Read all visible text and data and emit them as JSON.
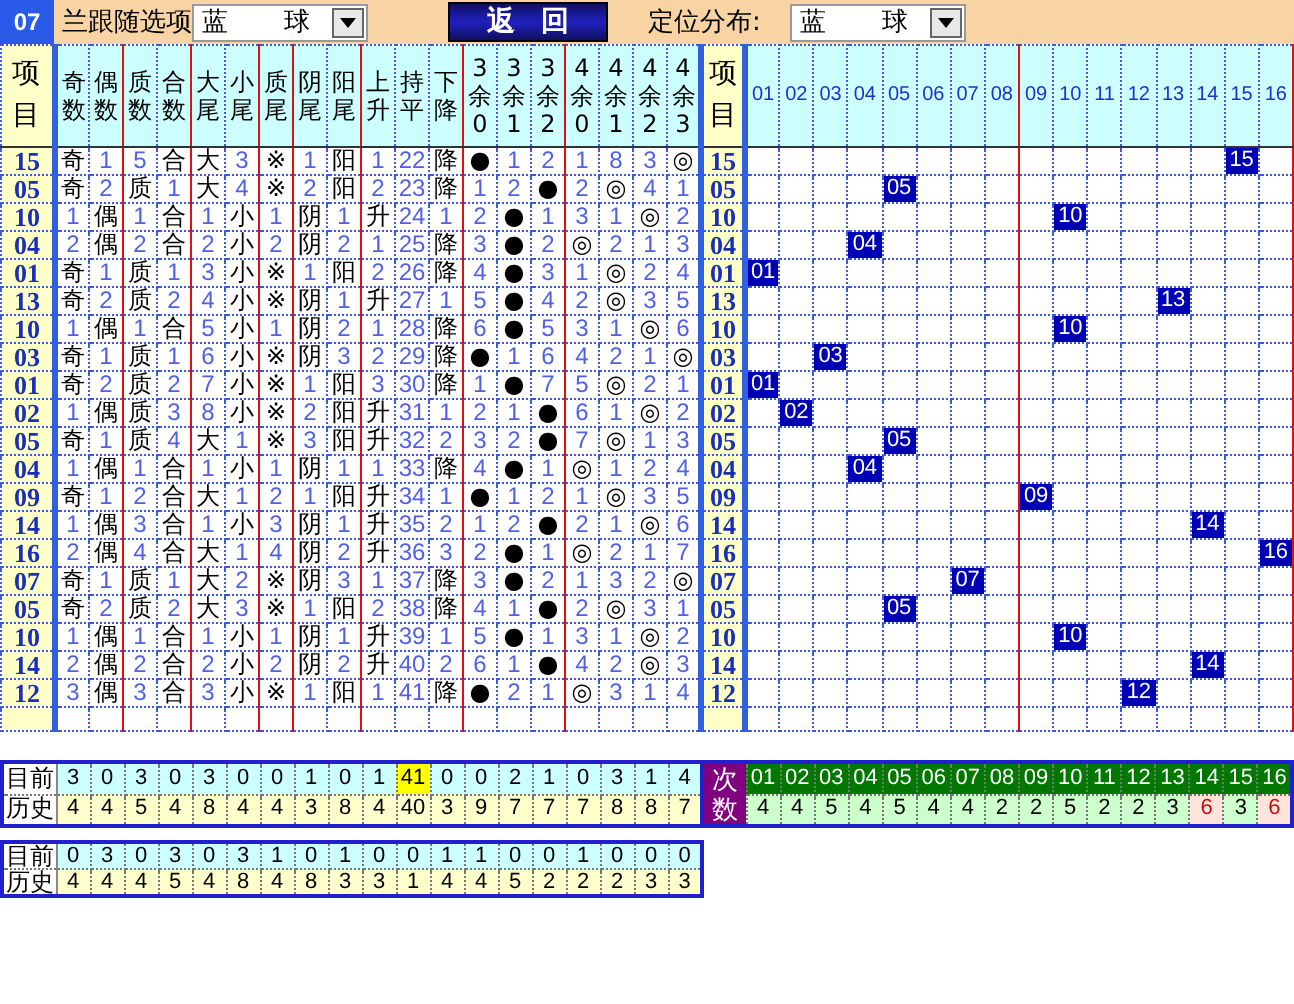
{
  "top_bar": {
    "badge": "07",
    "label": "兰跟随选项",
    "select_1": {
      "value": "蓝 球"
    },
    "button": "返 回",
    "label_2": "定位分布:",
    "select_2": {
      "value": "蓝 球"
    }
  },
  "table": {
    "item_header": "项目",
    "column_groups": [
      {
        "columns": [
          "奇数",
          "偶数"
        ]
      },
      {
        "columns": [
          "质数",
          "合数"
        ]
      },
      {
        "columns": [
          "大尾",
          "小尾"
        ]
      },
      {
        "columns": [
          "质尾"
        ]
      },
      {
        "columns": [
          "阴尾",
          "阳尾"
        ]
      },
      {
        "columns": [
          "上升",
          "持平",
          "下降"
        ]
      },
      {
        "columns": [
          "3余0",
          "3余1",
          "3余2"
        ]
      },
      {
        "columns": [
          "4余0",
          "4余1",
          "4余2",
          "4余3"
        ]
      }
    ],
    "item_header_2": "项目",
    "grid_groups": [
      {
        "columns": [
          "01",
          "02",
          "03",
          "04",
          "05",
          "06",
          "07",
          "08"
        ]
      },
      {
        "columns": [
          "09",
          "10",
          "11",
          "12",
          "13",
          "14",
          "15",
          "16"
        ]
      }
    ],
    "rows": [
      {
        "item": "15",
        "cells": [
          "奇",
          "1",
          "5",
          "合",
          "大",
          "3",
          "※",
          "1",
          "阳",
          "1",
          "22",
          "降",
          "●",
          "1",
          "2",
          "1",
          "8",
          "3",
          "◎"
        ],
        "hit": [
          true,
          false,
          false,
          true,
          true,
          false,
          true,
          false,
          true,
          false,
          false,
          true,
          true,
          false,
          false,
          false,
          false,
          false,
          true
        ],
        "item_2": "15",
        "ball": "15",
        "grid_hits": [
          false,
          false,
          false,
          false,
          false,
          false,
          false,
          false,
          false,
          false,
          false,
          false,
          false,
          false,
          true,
          false
        ]
      },
      {
        "item": "05",
        "cells": [
          "奇",
          "2",
          "质",
          "1",
          "大",
          "4",
          "※",
          "2",
          "阳",
          "2",
          "23",
          "降",
          "1",
          "2",
          "●",
          "2",
          "◎",
          "4",
          "1"
        ],
        "hit": [
          true,
          false,
          true,
          false,
          true,
          false,
          true,
          false,
          true,
          false,
          false,
          true,
          false,
          false,
          true,
          false,
          true,
          false,
          false
        ],
        "item_2": "05",
        "ball": "05",
        "grid_hits": [
          false,
          false,
          false,
          false,
          true,
          false,
          false,
          false,
          false,
          false,
          false,
          false,
          false,
          false,
          false,
          false
        ]
      },
      {
        "item": "10",
        "cells": [
          "1",
          "偶",
          "1",
          "合",
          "1",
          "小",
          "1",
          "阴",
          "1",
          "升",
          "24",
          "1",
          "2",
          "●",
          "1",
          "3",
          "1",
          "◎",
          "2"
        ],
        "hit": [
          false,
          true,
          false,
          true,
          false,
          true,
          false,
          true,
          false,
          true,
          false,
          false,
          false,
          true,
          false,
          false,
          false,
          true,
          false
        ],
        "item_2": "10",
        "ball": "10",
        "grid_hits": [
          false,
          false,
          false,
          false,
          false,
          false,
          false,
          false,
          false,
          true,
          false,
          false,
          false,
          false,
          false,
          false
        ]
      },
      {
        "item": "04",
        "cells": [
          "2",
          "偶",
          "2",
          "合",
          "2",
          "小",
          "2",
          "阴",
          "2",
          "1",
          "25",
          "降",
          "3",
          "●",
          "2",
          "◎",
          "2",
          "1",
          "3"
        ],
        "hit": [
          false,
          true,
          false,
          true,
          false,
          true,
          false,
          true,
          false,
          false,
          false,
          true,
          false,
          true,
          false,
          true,
          false,
          false,
          false
        ],
        "item_2": "04",
        "ball": "04",
        "grid_hits": [
          false,
          false,
          false,
          true,
          false,
          false,
          false,
          false,
          false,
          false,
          false,
          false,
          false,
          false,
          false,
          false
        ]
      },
      {
        "item": "01",
        "cells": [
          "奇",
          "1",
          "质",
          "1",
          "3",
          "小",
          "※",
          "1",
          "阳",
          "2",
          "26",
          "降",
          "4",
          "●",
          "3",
          "1",
          "◎",
          "2",
          "4"
        ],
        "hit": [
          true,
          false,
          true,
          false,
          false,
          true,
          true,
          false,
          true,
          false,
          false,
          true,
          false,
          true,
          false,
          false,
          true,
          false,
          false
        ],
        "item_2": "01",
        "ball": "01",
        "grid_hits": [
          true,
          false,
          false,
          false,
          false,
          false,
          false,
          false,
          false,
          false,
          false,
          false,
          false,
          false,
          false,
          false
        ]
      },
      {
        "item": "13",
        "cells": [
          "奇",
          "2",
          "质",
          "2",
          "4",
          "小",
          "※",
          "阴",
          "1",
          "升",
          "27",
          "1",
          "5",
          "●",
          "4",
          "2",
          "◎",
          "3",
          "5"
        ],
        "hit": [
          true,
          false,
          true,
          false,
          false,
          true,
          true,
          true,
          false,
          true,
          false,
          false,
          false,
          true,
          false,
          false,
          true,
          false,
          false
        ],
        "item_2": "13",
        "ball": "13",
        "grid_hits": [
          false,
          false,
          false,
          false,
          false,
          false,
          false,
          false,
          false,
          false,
          false,
          false,
          true,
          false,
          false,
          false
        ]
      },
      {
        "item": "10",
        "cells": [
          "1",
          "偶",
          "1",
          "合",
          "5",
          "小",
          "1",
          "阴",
          "2",
          "1",
          "28",
          "降",
          "6",
          "●",
          "5",
          "3",
          "1",
          "◎",
          "6"
        ],
        "hit": [
          false,
          true,
          false,
          true,
          false,
          true,
          false,
          true,
          false,
          false,
          false,
          true,
          false,
          true,
          false,
          false,
          false,
          true,
          false
        ],
        "item_2": "10",
        "ball": "10",
        "grid_hits": [
          false,
          false,
          false,
          false,
          false,
          false,
          false,
          false,
          false,
          true,
          false,
          false,
          false,
          false,
          false,
          false
        ]
      },
      {
        "item": "03",
        "cells": [
          "奇",
          "1",
          "质",
          "1",
          "6",
          "小",
          "※",
          "阴",
          "3",
          "2",
          "29",
          "降",
          "●",
          "1",
          "6",
          "4",
          "2",
          "1",
          "◎"
        ],
        "hit": [
          true,
          false,
          true,
          false,
          false,
          true,
          true,
          true,
          false,
          false,
          false,
          true,
          true,
          false,
          false,
          false,
          false,
          false,
          true
        ],
        "item_2": "03",
        "ball": "03",
        "grid_hits": [
          false,
          false,
          true,
          false,
          false,
          false,
          false,
          false,
          false,
          false,
          false,
          false,
          false,
          false,
          false,
          false
        ]
      },
      {
        "item": "01",
        "cells": [
          "奇",
          "2",
          "质",
          "2",
          "7",
          "小",
          "※",
          "1",
          "阳",
          "3",
          "30",
          "降",
          "1",
          "●",
          "7",
          "5",
          "◎",
          "2",
          "1"
        ],
        "hit": [
          true,
          false,
          true,
          false,
          false,
          true,
          true,
          false,
          true,
          false,
          false,
          true,
          false,
          true,
          false,
          false,
          true,
          false,
          false
        ],
        "item_2": "01",
        "ball": "01",
        "grid_hits": [
          true,
          false,
          false,
          false,
          false,
          false,
          false,
          false,
          false,
          false,
          false,
          false,
          false,
          false,
          false,
          false
        ]
      },
      {
        "item": "02",
        "cells": [
          "1",
          "偶",
          "质",
          "3",
          "8",
          "小",
          "※",
          "2",
          "阳",
          "升",
          "31",
          "1",
          "2",
          "1",
          "●",
          "6",
          "1",
          "◎",
          "2"
        ],
        "hit": [
          false,
          true,
          true,
          false,
          false,
          true,
          true,
          false,
          true,
          true,
          false,
          false,
          false,
          false,
          true,
          false,
          false,
          true,
          false
        ],
        "item_2": "02",
        "ball": "02",
        "grid_hits": [
          false,
          true,
          false,
          false,
          false,
          false,
          false,
          false,
          false,
          false,
          false,
          false,
          false,
          false,
          false,
          false
        ]
      },
      {
        "item": "05",
        "cells": [
          "奇",
          "1",
          "质",
          "4",
          "大",
          "1",
          "※",
          "3",
          "阳",
          "升",
          "32",
          "2",
          "3",
          "2",
          "●",
          "7",
          "◎",
          "1",
          "3"
        ],
        "hit": [
          true,
          false,
          true,
          false,
          true,
          false,
          true,
          false,
          true,
          true,
          false,
          false,
          false,
          false,
          true,
          false,
          true,
          false,
          false
        ],
        "item_2": "05",
        "ball": "05",
        "grid_hits": [
          false,
          false,
          false,
          false,
          true,
          false,
          false,
          false,
          false,
          false,
          false,
          false,
          false,
          false,
          false,
          false
        ]
      },
      {
        "item": "04",
        "cells": [
          "1",
          "偶",
          "1",
          "合",
          "1",
          "小",
          "1",
          "阴",
          "1",
          "1",
          "33",
          "降",
          "4",
          "●",
          "1",
          "◎",
          "1",
          "2",
          "4"
        ],
        "hit": [
          false,
          true,
          false,
          true,
          false,
          true,
          false,
          true,
          false,
          false,
          false,
          true,
          false,
          true,
          false,
          true,
          false,
          false,
          false
        ],
        "item_2": "04",
        "ball": "04",
        "grid_hits": [
          false,
          false,
          false,
          true,
          false,
          false,
          false,
          false,
          false,
          false,
          false,
          false,
          false,
          false,
          false,
          false
        ]
      },
      {
        "item": "09",
        "cells": [
          "奇",
          "1",
          "2",
          "合",
          "大",
          "1",
          "2",
          "1",
          "阳",
          "升",
          "34",
          "1",
          "●",
          "1",
          "2",
          "1",
          "◎",
          "3",
          "5"
        ],
        "hit": [
          true,
          false,
          false,
          true,
          true,
          false,
          false,
          false,
          true,
          true,
          false,
          false,
          true,
          false,
          false,
          false,
          true,
          false,
          false
        ],
        "item_2": "09",
        "ball": "09",
        "grid_hits": [
          false,
          false,
          false,
          false,
          false,
          false,
          false,
          false,
          true,
          false,
          false,
          false,
          false,
          false,
          false,
          false
        ]
      },
      {
        "item": "14",
        "cells": [
          "1",
          "偶",
          "3",
          "合",
          "1",
          "小",
          "3",
          "阴",
          "1",
          "升",
          "35",
          "2",
          "1",
          "2",
          "●",
          "2",
          "1",
          "◎",
          "6"
        ],
        "hit": [
          false,
          true,
          false,
          true,
          false,
          true,
          false,
          true,
          false,
          true,
          false,
          false,
          false,
          false,
          true,
          false,
          false,
          true,
          false
        ],
        "item_2": "14",
        "ball": "14",
        "grid_hits": [
          false,
          false,
          false,
          false,
          false,
          false,
          false,
          false,
          false,
          false,
          false,
          false,
          false,
          true,
          false,
          false
        ]
      },
      {
        "item": "16",
        "cells": [
          "2",
          "偶",
          "4",
          "合",
          "大",
          "1",
          "4",
          "阴",
          "2",
          "升",
          "36",
          "3",
          "2",
          "●",
          "1",
          "◎",
          "2",
          "1",
          "7"
        ],
        "hit": [
          false,
          true,
          false,
          true,
          true,
          false,
          false,
          true,
          false,
          true,
          false,
          false,
          false,
          true,
          false,
          true,
          false,
          false,
          false
        ],
        "item_2": "16",
        "ball": "16",
        "grid_hits": [
          false,
          false,
          false,
          false,
          false,
          false,
          false,
          false,
          false,
          false,
          false,
          false,
          false,
          false,
          false,
          true
        ]
      },
      {
        "item": "07",
        "cells": [
          "奇",
          "1",
          "质",
          "1",
          "大",
          "2",
          "※",
          "阴",
          "3",
          "1",
          "37",
          "降",
          "3",
          "●",
          "2",
          "1",
          "3",
          "2",
          "◎"
        ],
        "hit": [
          true,
          false,
          true,
          false,
          true,
          false,
          true,
          true,
          false,
          false,
          false,
          true,
          false,
          true,
          false,
          false,
          false,
          false,
          true
        ],
        "item_2": "07",
        "ball": "07",
        "grid_hits": [
          false,
          false,
          false,
          false,
          false,
          false,
          true,
          false,
          false,
          false,
          false,
          false,
          false,
          false,
          false,
          false
        ]
      },
      {
        "item": "05",
        "cells": [
          "奇",
          "2",
          "质",
          "2",
          "大",
          "3",
          "※",
          "1",
          "阳",
          "2",
          "38",
          "降",
          "4",
          "1",
          "●",
          "2",
          "◎",
          "3",
          "1"
        ],
        "hit": [
          true,
          false,
          true,
          false,
          true,
          false,
          true,
          false,
          true,
          false,
          false,
          true,
          false,
          false,
          true,
          false,
          true,
          false,
          false
        ],
        "item_2": "05",
        "ball": "05",
        "grid_hits": [
          false,
          false,
          false,
          false,
          true,
          false,
          false,
          false,
          false,
          false,
          false,
          false,
          false,
          false,
          false,
          false
        ]
      },
      {
        "item": "10",
        "cells": [
          "1",
          "偶",
          "1",
          "合",
          "1",
          "小",
          "1",
          "阴",
          "1",
          "升",
          "39",
          "1",
          "5",
          "●",
          "1",
          "3",
          "1",
          "◎",
          "2"
        ],
        "hit": [
          false,
          true,
          false,
          true,
          false,
          true,
          false,
          true,
          false,
          true,
          false,
          false,
          false,
          true,
          false,
          false,
          false,
          true,
          false
        ],
        "item_2": "10",
        "ball": "10",
        "grid_hits": [
          false,
          false,
          false,
          false,
          false,
          false,
          false,
          false,
          false,
          true,
          false,
          false,
          false,
          false,
          false,
          false
        ]
      },
      {
        "item": "14",
        "cells": [
          "2",
          "偶",
          "2",
          "合",
          "2",
          "小",
          "2",
          "阴",
          "2",
          "升",
          "40",
          "2",
          "6",
          "1",
          "●",
          "4",
          "2",
          "◎",
          "3"
        ],
        "hit": [
          false,
          true,
          false,
          true,
          false,
          true,
          false,
          true,
          false,
          true,
          false,
          false,
          false,
          false,
          true,
          false,
          false,
          true,
          false
        ],
        "item_2": "14",
        "ball": "14",
        "grid_hits": [
          false,
          false,
          false,
          false,
          false,
          false,
          false,
          false,
          false,
          false,
          false,
          false,
          false,
          true,
          false,
          false
        ]
      },
      {
        "item": "12",
        "cells": [
          "3",
          "偶",
          "3",
          "合",
          "3",
          "小",
          "※",
          "1",
          "阳",
          "1",
          "41",
          "降",
          "●",
          "2",
          "1",
          "◎",
          "3",
          "1",
          "4"
        ],
        "hit": [
          false,
          true,
          false,
          true,
          false,
          true,
          true,
          false,
          true,
          false,
          false,
          true,
          true,
          false,
          false,
          true,
          false,
          false,
          false
        ],
        "item_2": "12",
        "ball": "12",
        "grid_hits": [
          false,
          false,
          false,
          false,
          false,
          false,
          false,
          false,
          false,
          false,
          false,
          true,
          false,
          false,
          false,
          false
        ]
      }
    ]
  },
  "summary": {
    "rows": [
      {
        "label": "目前",
        "values": [
          "3",
          "0",
          "3",
          "0",
          "3",
          "0",
          "0",
          "1",
          "0",
          "1",
          "41",
          "0",
          "0",
          "2",
          "1",
          "0",
          "3",
          "1",
          "4"
        ],
        "highlighted": [
          false,
          false,
          false,
          false,
          false,
          false,
          false,
          false,
          false,
          false,
          true,
          false,
          false,
          false,
          false,
          false,
          false,
          false,
          false
        ]
      },
      {
        "label": "历史",
        "values": [
          "4",
          "4",
          "5",
          "4",
          "8",
          "4",
          "4",
          "3",
          "8",
          "4",
          "40",
          "3",
          "9",
          "7",
          "7",
          "7",
          "8",
          "8",
          "7"
        ],
        "highlighted": [
          false,
          false,
          false,
          false,
          false,
          false,
          false,
          false,
          false,
          false,
          false,
          false,
          false,
          false,
          false,
          false,
          false,
          false,
          false
        ]
      }
    ],
    "counts": {
      "label": "次数",
      "columns": [
        "01",
        "02",
        "03",
        "04",
        "05",
        "06",
        "07",
        "08",
        "09",
        "10",
        "11",
        "12",
        "13",
        "14",
        "15",
        "16"
      ],
      "values": [
        {
          "text": "4",
          "hot": false
        },
        {
          "text": "4",
          "hot": false
        },
        {
          "text": "5",
          "hot": false
        },
        {
          "text": "4",
          "hot": false
        },
        {
          "text": "5",
          "hot": false
        },
        {
          "text": "4",
          "hot": false
        },
        {
          "text": "4",
          "hot": false
        },
        {
          "text": "2",
          "hot": false
        },
        {
          "text": "2",
          "hot": false
        },
        {
          "text": "5",
          "hot": false
        },
        {
          "text": "2",
          "hot": false
        },
        {
          "text": "2",
          "hot": false
        },
        {
          "text": "3",
          "hot": false
        },
        {
          "text": "6",
          "hot": true
        },
        {
          "text": "3",
          "hot": false
        },
        {
          "text": "6",
          "hot": true
        }
      ]
    }
  },
  "summary_2": {
    "rows": [
      {
        "label": "目前",
        "values": [
          "0",
          "3",
          "0",
          "3",
          "0",
          "3",
          "1",
          "0",
          "1",
          "0",
          "0",
          "1",
          "1",
          "0",
          "0",
          "1",
          "0",
          "0",
          "0"
        ]
      },
      {
        "label": "历史",
        "values": [
          "4",
          "4",
          "4",
          "5",
          "4",
          "8",
          "4",
          "8",
          "3",
          "3",
          "1",
          "4",
          "4",
          "5",
          "2",
          "2",
          "2",
          "3",
          "3"
        ]
      }
    ]
  }
}
